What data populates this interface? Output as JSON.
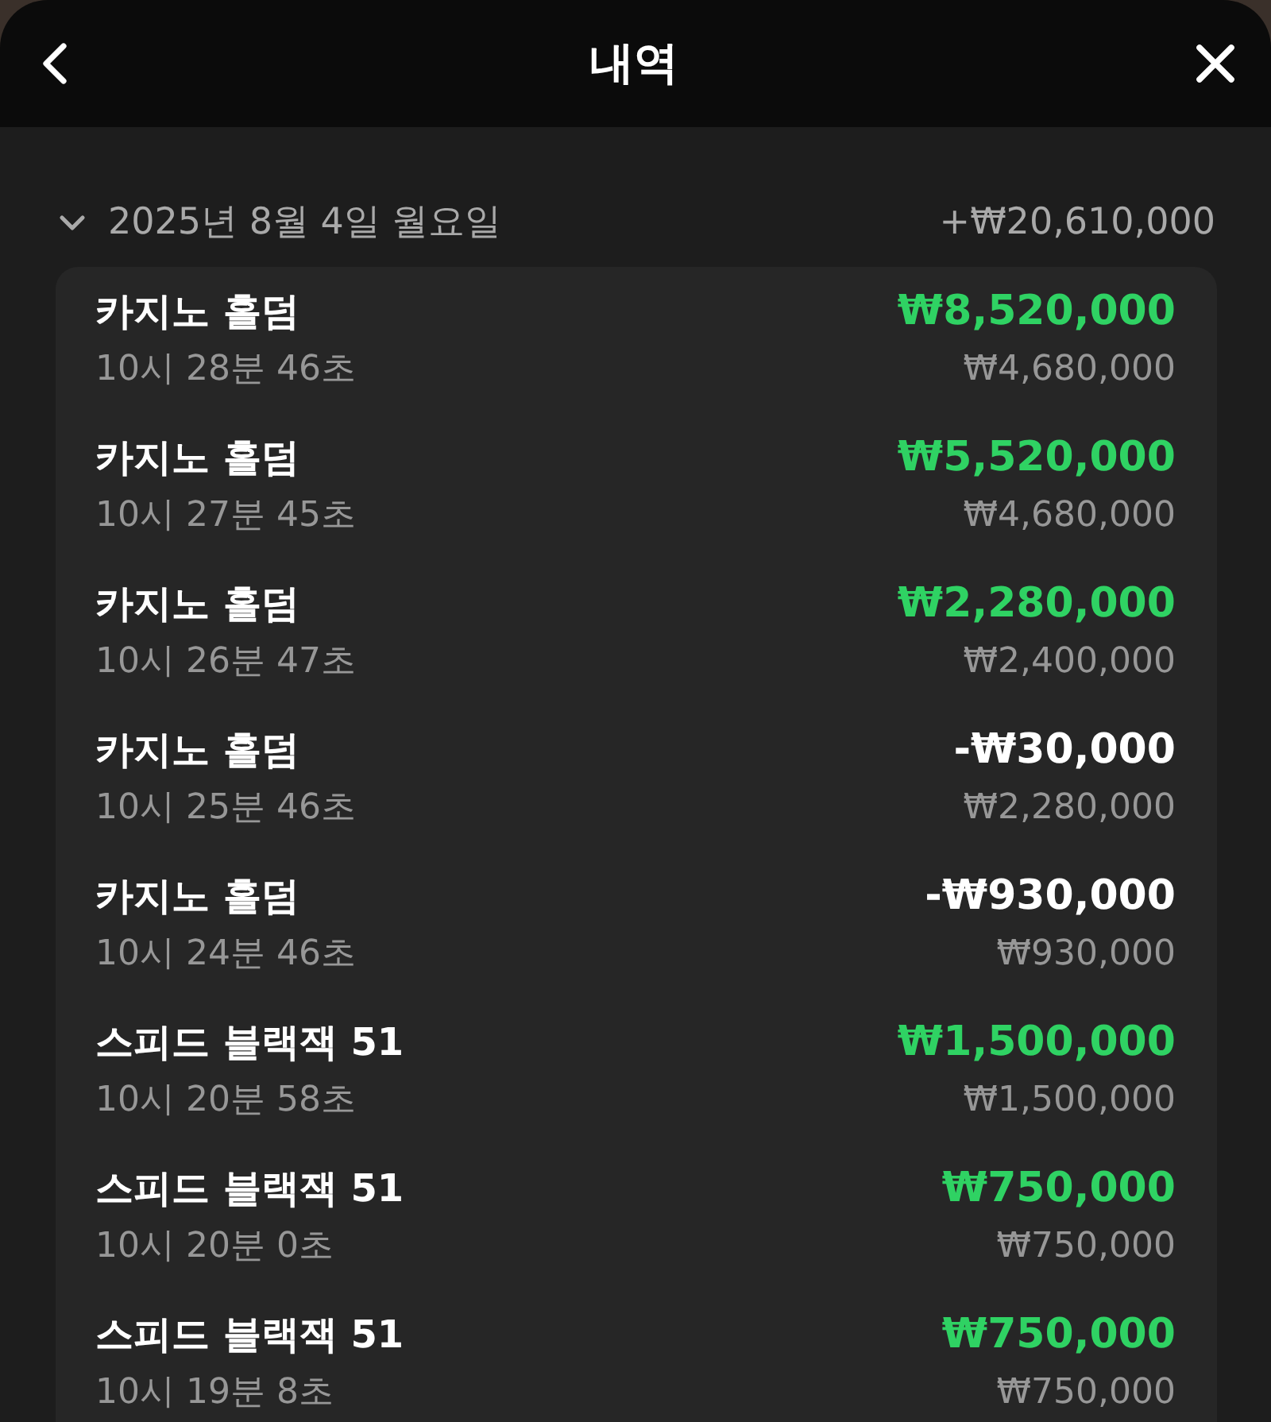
{
  "header": {
    "title": "내역"
  },
  "day": {
    "date": "2025년 8월 4일 월요일",
    "total": "+₩20,610,000",
    "expanded": true
  },
  "transactions": [
    {
      "game": "카지노 홀덤",
      "time": "10시 28분 46초",
      "amount": "₩8,520,000",
      "kind": "gain",
      "balance": "₩4,680,000"
    },
    {
      "game": "카지노 홀덤",
      "time": "10시 27분 45초",
      "amount": "₩5,520,000",
      "kind": "gain",
      "balance": "₩4,680,000"
    },
    {
      "game": "카지노 홀덤",
      "time": "10시 26분 47초",
      "amount": "₩2,280,000",
      "kind": "gain",
      "balance": "₩2,400,000"
    },
    {
      "game": "카지노 홀덤",
      "time": "10시 25분 46초",
      "amount": "-₩30,000",
      "kind": "loss",
      "balance": "₩2,280,000"
    },
    {
      "game": "카지노 홀덤",
      "time": "10시 24분 46초",
      "amount": "-₩930,000",
      "kind": "loss",
      "balance": "₩930,000"
    },
    {
      "game": "스피드 블랙잭 51",
      "time": "10시 20분 58초",
      "amount": "₩1,500,000",
      "kind": "gain",
      "balance": "₩1,500,000"
    },
    {
      "game": "스피드 블랙잭 51",
      "time": "10시 20분 0초",
      "amount": "₩750,000",
      "kind": "gain",
      "balance": "₩750,000"
    },
    {
      "game": "스피드 블랙잭 51",
      "time": "10시 19분 8초",
      "amount": "₩750,000",
      "kind": "gain",
      "balance": "₩750,000"
    }
  ]
}
